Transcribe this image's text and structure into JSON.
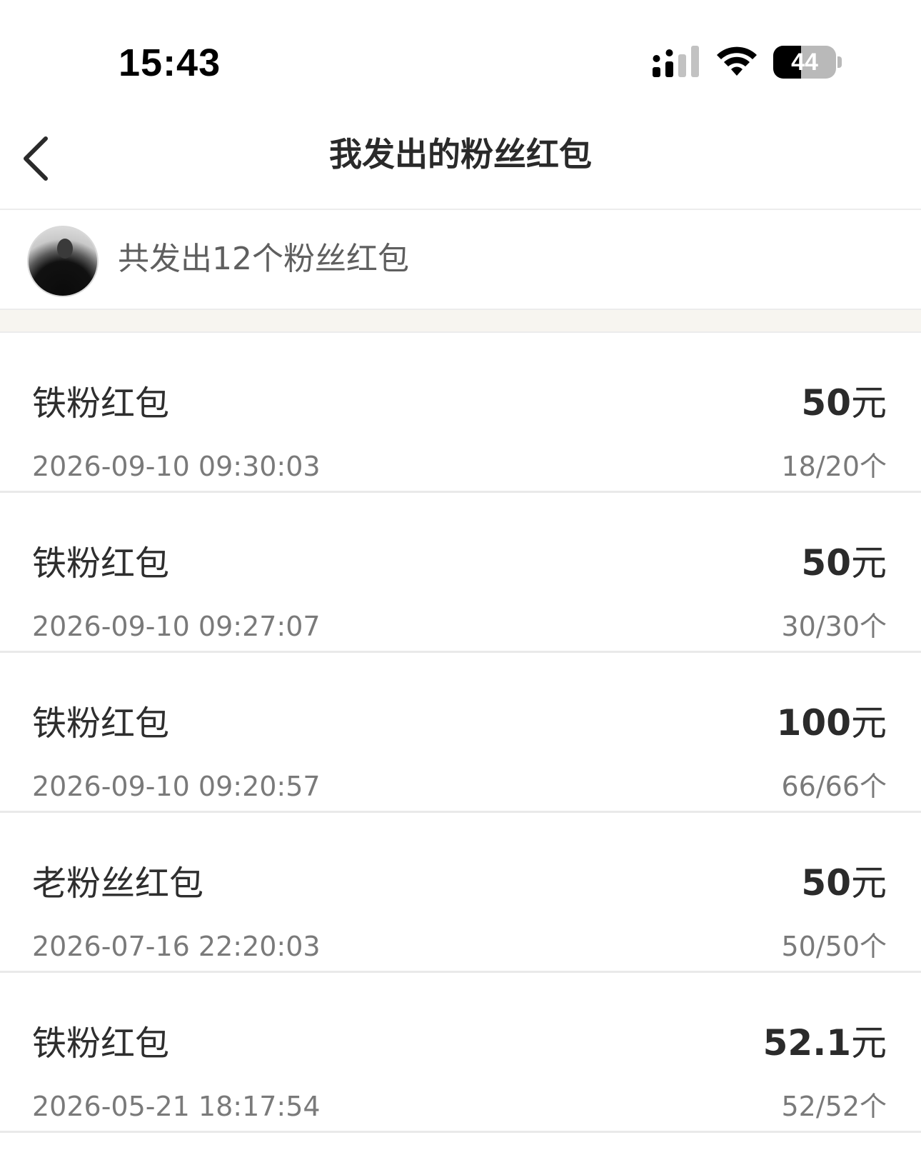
{
  "status_bar": {
    "time": "15:43",
    "battery_level": "44",
    "battery_fraction": 0.44
  },
  "nav": {
    "back_icon": "chevron-left-icon",
    "title": "我发出的粉丝红包"
  },
  "summary": {
    "text": "共发出12个粉丝红包"
  },
  "items": [
    {
      "name": "铁粉红包",
      "amount": "50",
      "unit": "元",
      "time": "2026-09-10 09:30:03",
      "count": "18/20个"
    },
    {
      "name": "铁粉红包",
      "amount": "50",
      "unit": "元",
      "time": "2026-09-10 09:27:07",
      "count": "30/30个"
    },
    {
      "name": "铁粉红包",
      "amount": "100",
      "unit": "元",
      "time": "2026-09-10 09:20:57",
      "count": "66/66个"
    },
    {
      "name": "老粉丝红包",
      "amount": "50",
      "unit": "元",
      "time": "2026-07-16 22:20:03",
      "count": "50/50个"
    },
    {
      "name": "铁粉红包",
      "amount": "52.1",
      "unit": "元",
      "time": "2026-05-21 18:17:54",
      "count": "52/52个"
    }
  ]
}
